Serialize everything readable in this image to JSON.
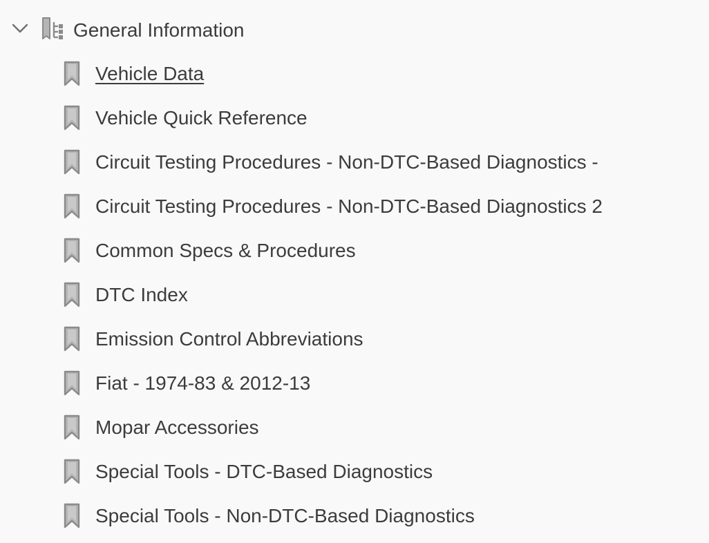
{
  "tree": {
    "parent": {
      "label": "General Information",
      "expanded": true,
      "chevron_icon": "chevron-down-icon",
      "icon": "document-tree-icon"
    },
    "children": [
      {
        "label": "Vehicle Data",
        "icon": "bookmark-icon",
        "current": true
      },
      {
        "label": "Vehicle Quick Reference",
        "icon": "bookmark-icon"
      },
      {
        "label": "Circuit Testing Procedures - Non-DTC-Based Diagnostics -",
        "icon": "bookmark-icon"
      },
      {
        "label": "Circuit Testing Procedures - Non-DTC-Based Diagnostics 2",
        "icon": "bookmark-icon"
      },
      {
        "label": "Common Specs & Procedures",
        "icon": "bookmark-icon"
      },
      {
        "label": "DTC Index",
        "icon": "bookmark-icon"
      },
      {
        "label": "Emission Control Abbreviations",
        "icon": "bookmark-icon"
      },
      {
        "label": "Fiat - 1974-83 & 2012-13",
        "icon": "bookmark-icon"
      },
      {
        "label": "Mopar Accessories",
        "icon": "bookmark-icon"
      },
      {
        "label": "Special Tools - DTC-Based Diagnostics",
        "icon": "bookmark-icon"
      },
      {
        "label": "Special Tools - Non-DTC-Based Diagnostics",
        "icon": "bookmark-icon"
      }
    ]
  },
  "colors": {
    "background": "#f9f9f9",
    "text": "#3c3c3c",
    "icon": "#8a8a8a",
    "icon_fill": "#b5b5b5"
  }
}
